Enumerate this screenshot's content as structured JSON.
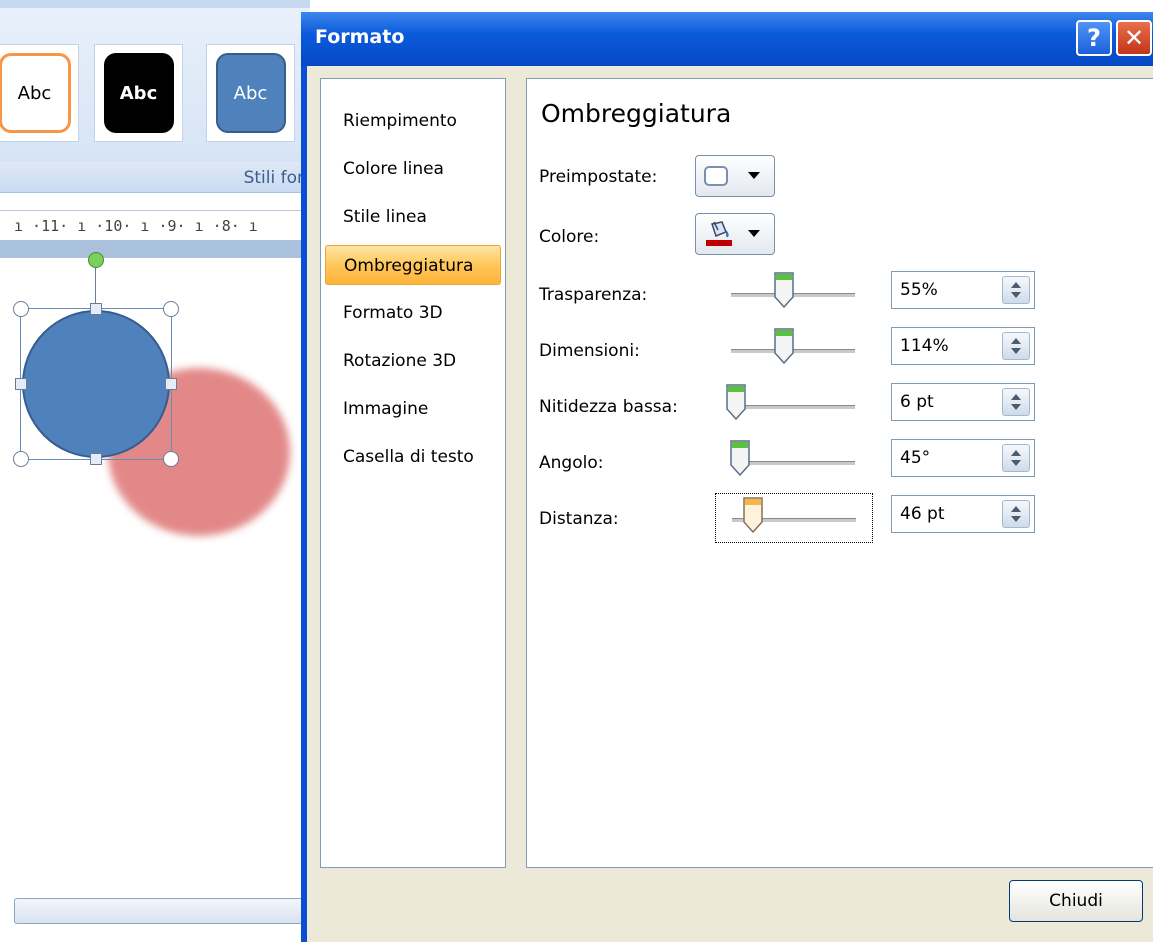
{
  "background_app": {
    "gallery": [
      {
        "label": "Abc",
        "fill": "#ffffff",
        "border": "#f79646",
        "text_color": "#000000"
      },
      {
        "label": "Abc",
        "fill": "#000000",
        "border": "#000000",
        "text_color": "#ffffff"
      },
      {
        "label": "Abc",
        "fill": "#4f81bd",
        "border": "#385d8a",
        "text_color": "#ffffff"
      }
    ],
    "group_label": "Stili for",
    "ruler_text": "ı ·11· ı ·10· ı ·9· ı ·8· ı",
    "shape_color": "#4f81bd",
    "shadow_color": "#e07c7c"
  },
  "dialog": {
    "title": "Formato",
    "help_button": "?",
    "close_button": "✕",
    "nav_items": [
      {
        "label": "Riempimento",
        "active": false
      },
      {
        "label": "Colore linea",
        "active": false
      },
      {
        "label": "Stile linea",
        "active": false
      },
      {
        "label": "Ombreggiatura",
        "active": true
      },
      {
        "label": "Formato 3D",
        "active": false
      },
      {
        "label": "Rotazione 3D",
        "active": false
      },
      {
        "label": "Immagine",
        "active": false
      },
      {
        "label": "Casella di testo",
        "active": false
      }
    ],
    "panel_title": "Ombreggiatura",
    "preset": {
      "label": "Preimpostate:",
      "accesskey": "P",
      "icon": "shadow-preset-icon"
    },
    "color": {
      "label": "Colore:",
      "accesskey": "C",
      "icon": "paint-bucket-icon",
      "current_color": "#c00000"
    },
    "sliders": [
      {
        "key": "trasparenza",
        "label": "Trasparenza:",
        "accesskey": "s",
        "value": "55%",
        "level": 0.55,
        "thumb_color": "green"
      },
      {
        "key": "dimensioni",
        "label": "Dimensioni:",
        "accesskey": "D",
        "value": "114%",
        "level": 0.57,
        "thumb_color": "green"
      },
      {
        "key": "nitidezza",
        "label": "Nitidezza bassa:",
        "accesskey": "z",
        "value": "6 pt",
        "level": 0.06,
        "thumb_color": "green"
      },
      {
        "key": "angolo",
        "label": "Angolo:",
        "accesskey": "n",
        "value": "45°",
        "level": 0.13,
        "thumb_color": "green"
      },
      {
        "key": "distanza",
        "label": "Distanza:",
        "accesskey": "t",
        "value": "46 pt",
        "level": 0.23,
        "thumb_color": "orange",
        "focused": true
      }
    ],
    "close_dialog_button": "Chiudi"
  }
}
